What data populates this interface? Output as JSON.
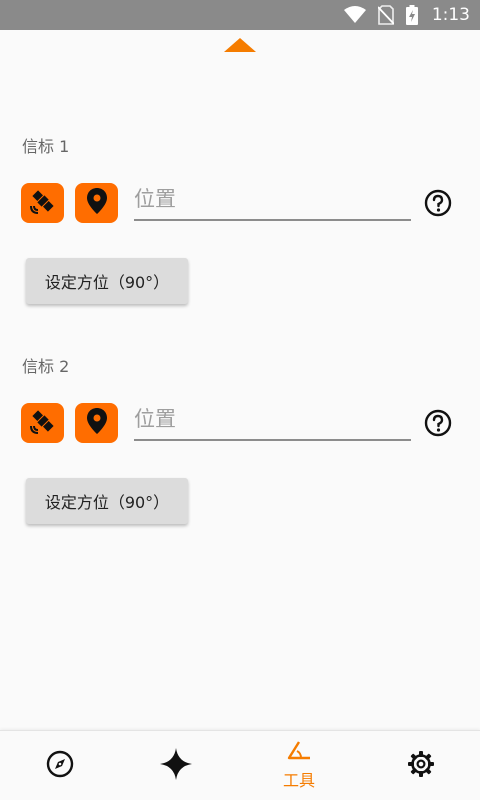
{
  "status_bar": {
    "time": "1:13",
    "icons": [
      "wifi-icon",
      "no-sim-icon",
      "battery-charging-icon"
    ]
  },
  "beacons": [
    {
      "label": "信标 1",
      "location_placeholder": "位置",
      "location_value": "",
      "bearing_button": "设定方位（90°）"
    },
    {
      "label": "信标 2",
      "location_placeholder": "位置",
      "location_value": "",
      "bearing_button": "设定方位（90°）"
    }
  ],
  "bottom_nav": {
    "items": [
      {
        "icon": "compass-icon",
        "label": ""
      },
      {
        "icon": "astronomy-star-icon",
        "label": ""
      },
      {
        "icon": "angle-tool-icon",
        "label": "工具",
        "active": true
      },
      {
        "icon": "settings-gear-icon",
        "label": ""
      }
    ]
  },
  "colors": {
    "accent": "#ff6d00",
    "status_bar": "#8a8a8a",
    "background": "#fafafa",
    "button_bg": "#dcdcdc"
  }
}
